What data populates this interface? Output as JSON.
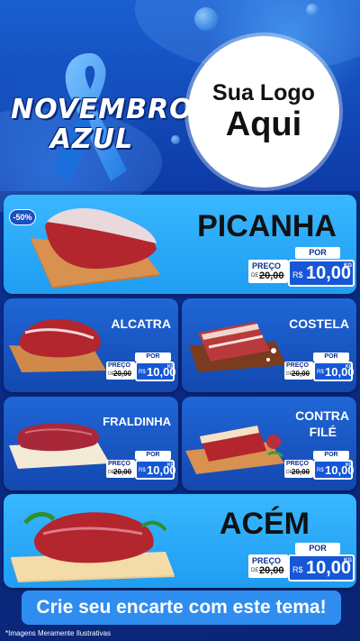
{
  "campaign": {
    "line1": "NOVEMBRO",
    "line2": "AZUL"
  },
  "logo": {
    "line1": "Sua Logo",
    "line2": "Aqui"
  },
  "colors": {
    "accent": "#1557d6",
    "background": "#0b2f8f",
    "light_card": "#2ba7f8",
    "banner": "#2f8df0"
  },
  "discount_badge": "-50%",
  "products": {
    "picanha": {
      "name": "PICANHA",
      "por": "POR",
      "preco": "PREÇO",
      "de": "DE",
      "old": "20,00",
      "cur": "R$",
      "new": "10,00",
      "unit": "KG"
    },
    "alcatra": {
      "name": "ALCATRA",
      "por": "POR",
      "preco": "PREÇO",
      "de": "DE",
      "old": "20,00",
      "cur": "R$",
      "new": "10,00",
      "unit": "KG"
    },
    "costela": {
      "name": "COSTELA",
      "por": "POR",
      "preco": "PREÇO",
      "de": "DE",
      "old": "20,00",
      "cur": "R$",
      "new": "10,00",
      "unit": "KG"
    },
    "fraldinha": {
      "name": "FRALDINHA",
      "por": "POR",
      "preco": "PREÇO",
      "de": "DE",
      "old": "20,00",
      "cur": "R$",
      "new": "10,00",
      "unit": "KG"
    },
    "contrafile": {
      "name_line1": "CONTRA",
      "name_line2": "FILÉ",
      "por": "POR",
      "preco": "PREÇO",
      "de": "DE",
      "old": "20,00",
      "cur": "R$",
      "new": "10,00",
      "unit": "KG"
    },
    "acem": {
      "name": "ACÉM",
      "por": "POR",
      "preco": "PREÇO",
      "de": "DE",
      "old": "20,00",
      "cur": "R$",
      "new": "10,00",
      "unit": "KG"
    }
  },
  "banner": "Crie seu encarte com este tema!",
  "disclaimer": "*Imagens Meramente Ilustrativas"
}
